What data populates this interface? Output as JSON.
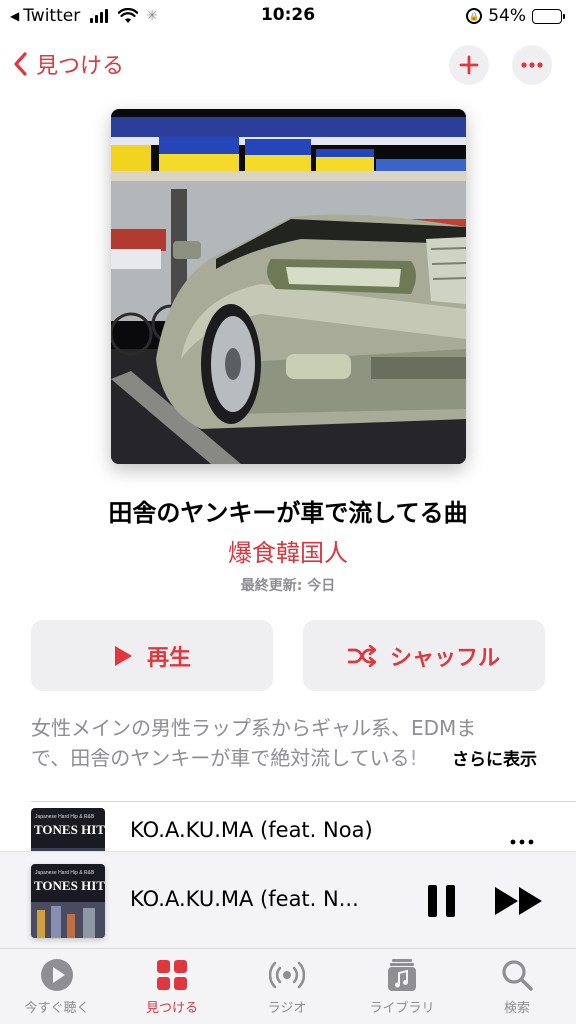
{
  "statusbar": {
    "back_app": "Twitter",
    "time": "10:26",
    "battery": "54%",
    "battery_level": 0.54
  },
  "nav": {
    "back_label": "見つける"
  },
  "playlist": {
    "title": "田舎のヤンキーが車で流してる曲",
    "author": "爆食韓国人",
    "updated": "最終更新: 今日",
    "play_label": "再生",
    "shuffle_label": "シャッフル",
    "description_line1": "女性メインの男性ラップ系からギャル系、EDMま",
    "description_line2": "で、田舎のヤンキーが車で絶対流している!",
    "more_label": "さらに表示"
  },
  "tracks": [
    {
      "title": "KO.A.KU.MA (feat. Noa)",
      "art_text": "TONES HITS",
      "art_subtext": "Japanese Hard Hip & R&B"
    }
  ],
  "now_playing": {
    "title": "KO.A.KU.MA (feat. N...",
    "art_text": "TONES HITS",
    "art_subtext": "Japanese Hard Hip & R&B"
  },
  "tabs": [
    {
      "label": "今すぐ聴く",
      "icon": "play-circle-icon",
      "active": false
    },
    {
      "label": "見つける",
      "icon": "grid-icon",
      "active": true
    },
    {
      "label": "ラジオ",
      "icon": "radio-waves-icon",
      "active": false
    },
    {
      "label": "ライブラリ",
      "icon": "music-library-icon",
      "active": false
    },
    {
      "label": "検索",
      "icon": "search-icon",
      "active": false
    }
  ],
  "colors": {
    "accent": "#e0373f",
    "secondary_text": "#8e8e93",
    "button_bg": "#efeff2"
  }
}
